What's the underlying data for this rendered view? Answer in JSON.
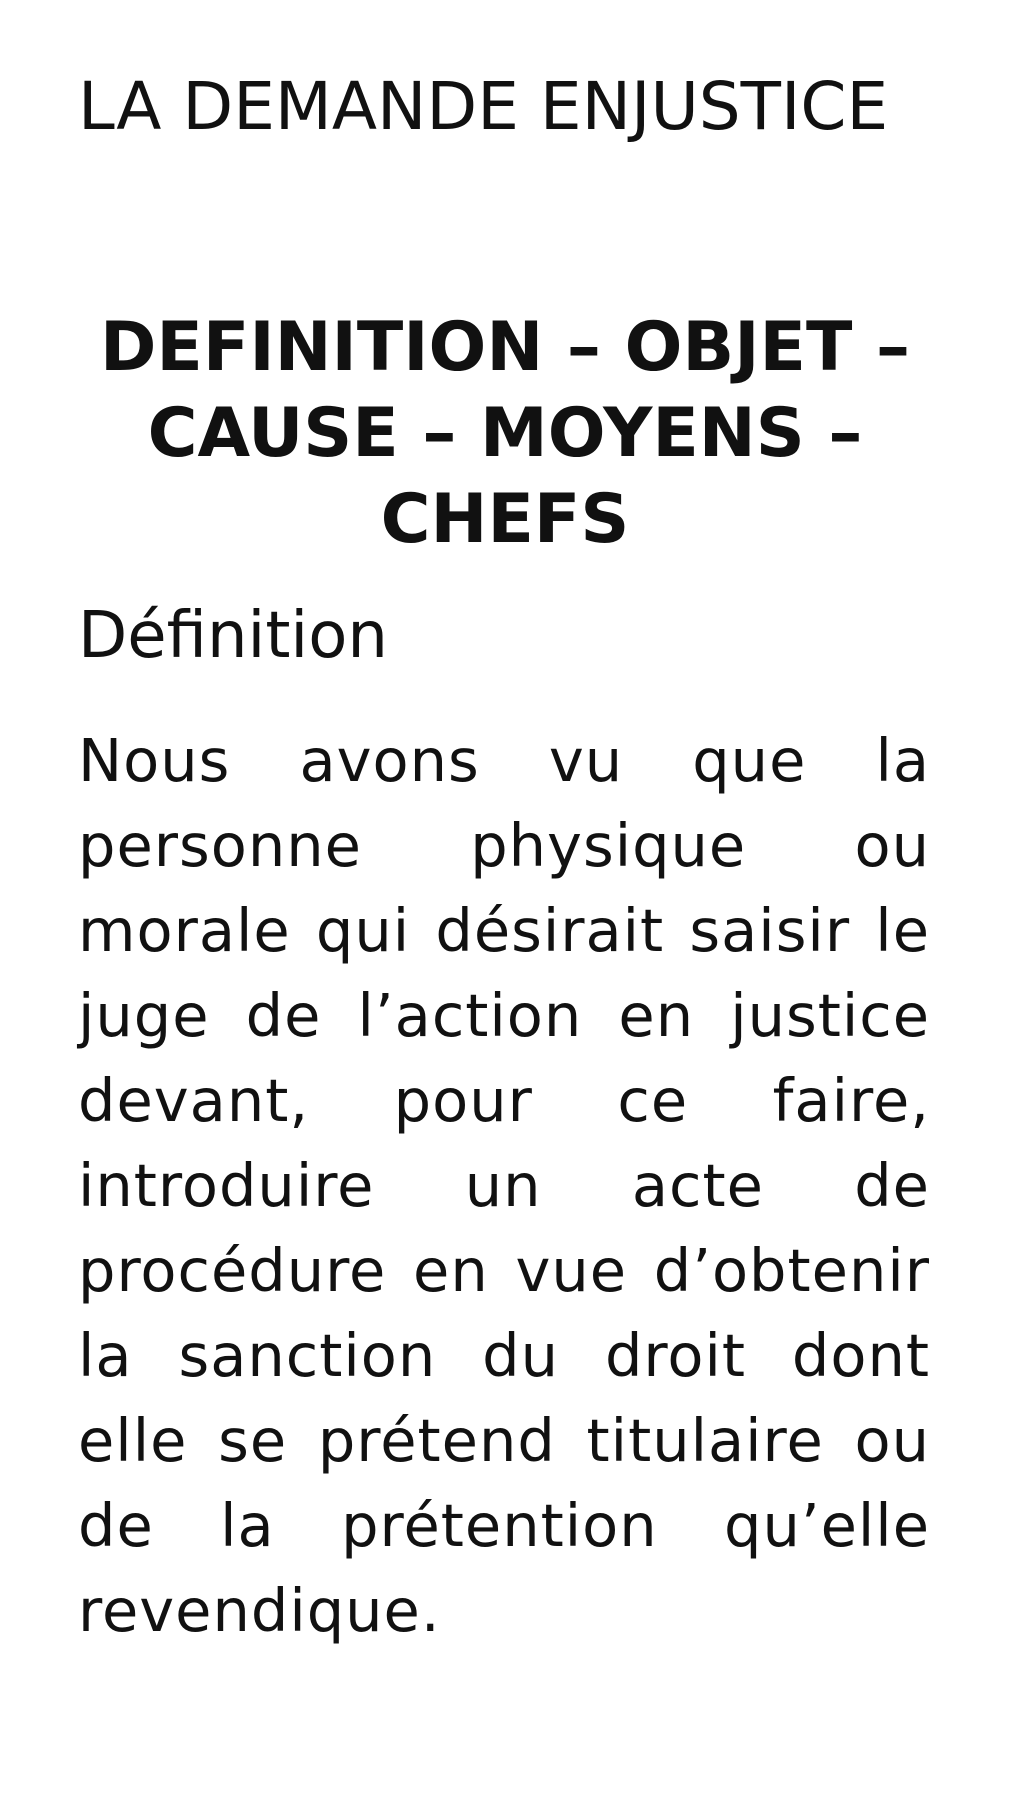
{
  "document": {
    "running_title": "LA DEMANDE ENJUSTICE",
    "section_heading": "DEFINITION – OBJET – CAUSE – MOYENS – CHEFS",
    "subheading": "Définition",
    "body": "Nous avons vu que la personne physique ou morale qui désirait saisir le juge de l’action en justice devant, pour ce faire, introduire un acte de procédure en vue d’obtenir la sanction du droit dont elle se prétend titulaire ou de la prétention qu’elle revendique."
  },
  "colors": {
    "background": "#ffffff",
    "text": "#111111"
  }
}
